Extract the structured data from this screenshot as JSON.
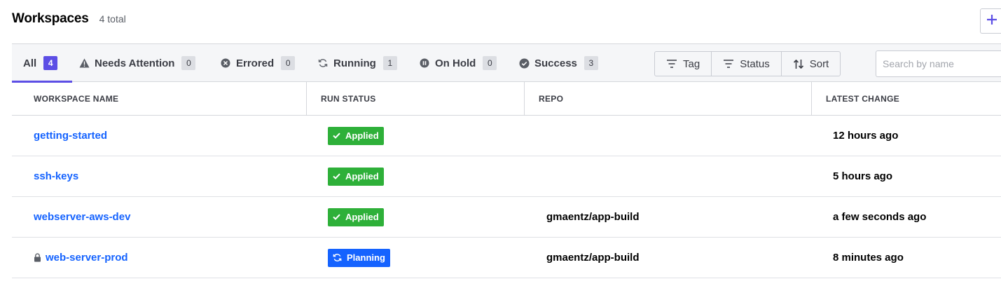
{
  "header": {
    "title": "Workspaces",
    "count": "4 total"
  },
  "tabs": [
    {
      "label": "All",
      "count": "4",
      "icon": "none",
      "active": true
    },
    {
      "label": "Needs Attention",
      "count": "0",
      "icon": "warning-icon"
    },
    {
      "label": "Errored",
      "count": "0",
      "icon": "error-icon"
    },
    {
      "label": "Running",
      "count": "1",
      "icon": "running-icon"
    },
    {
      "label": "On Hold",
      "count": "0",
      "icon": "pause-icon"
    },
    {
      "label": "Success",
      "count": "3",
      "icon": "check-circle-icon"
    }
  ],
  "filters": {
    "tag": "Tag",
    "status": "Status",
    "sort": "Sort"
  },
  "search": {
    "placeholder": "Search by name",
    "value": ""
  },
  "columns": [
    "WORKSPACE NAME",
    "RUN STATUS",
    "REPO",
    "LATEST CHANGE"
  ],
  "rows": [
    {
      "name": "getting-started",
      "locked": false,
      "status": "Applied",
      "repo": "",
      "latest": "12 hours ago"
    },
    {
      "name": "ssh-keys",
      "locked": false,
      "status": "Applied",
      "repo": "",
      "latest": "5 hours ago"
    },
    {
      "name": "webserver-aws-dev",
      "locked": false,
      "status": "Applied",
      "repo": "gmaentz/app-build",
      "latest": "a few seconds ago"
    },
    {
      "name": "web-server-prod",
      "locked": true,
      "status": "Planning",
      "repo": "gmaentz/app-build",
      "latest": "8 minutes ago"
    }
  ],
  "colors": {
    "accent": "#5c4ee5",
    "link": "#1563ff",
    "applied": "#2eb039",
    "planning": "#1563ff"
  }
}
